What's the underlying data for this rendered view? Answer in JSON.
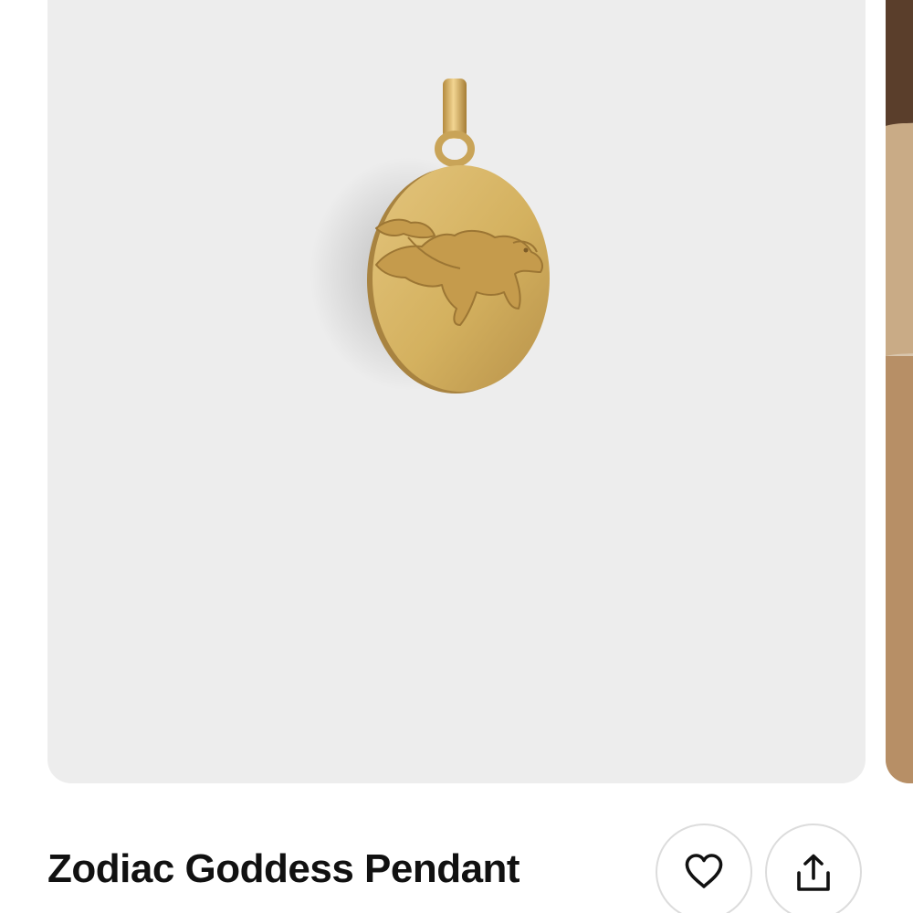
{
  "product": {
    "title": "Zodiac Goddess Pendant"
  },
  "gallery": {
    "main_image": "gold-oval-zodiac-pendant-lion-goddess-relief",
    "next_image_preview": "model-wearing-pendant"
  },
  "actions": {
    "favorite_icon": "heart-outline-icon",
    "share_icon": "share-upload-icon"
  },
  "colors": {
    "image_background": "#ededed",
    "gold": "#d4b15f",
    "text": "#111111",
    "button_border": "#dcdcdc"
  }
}
